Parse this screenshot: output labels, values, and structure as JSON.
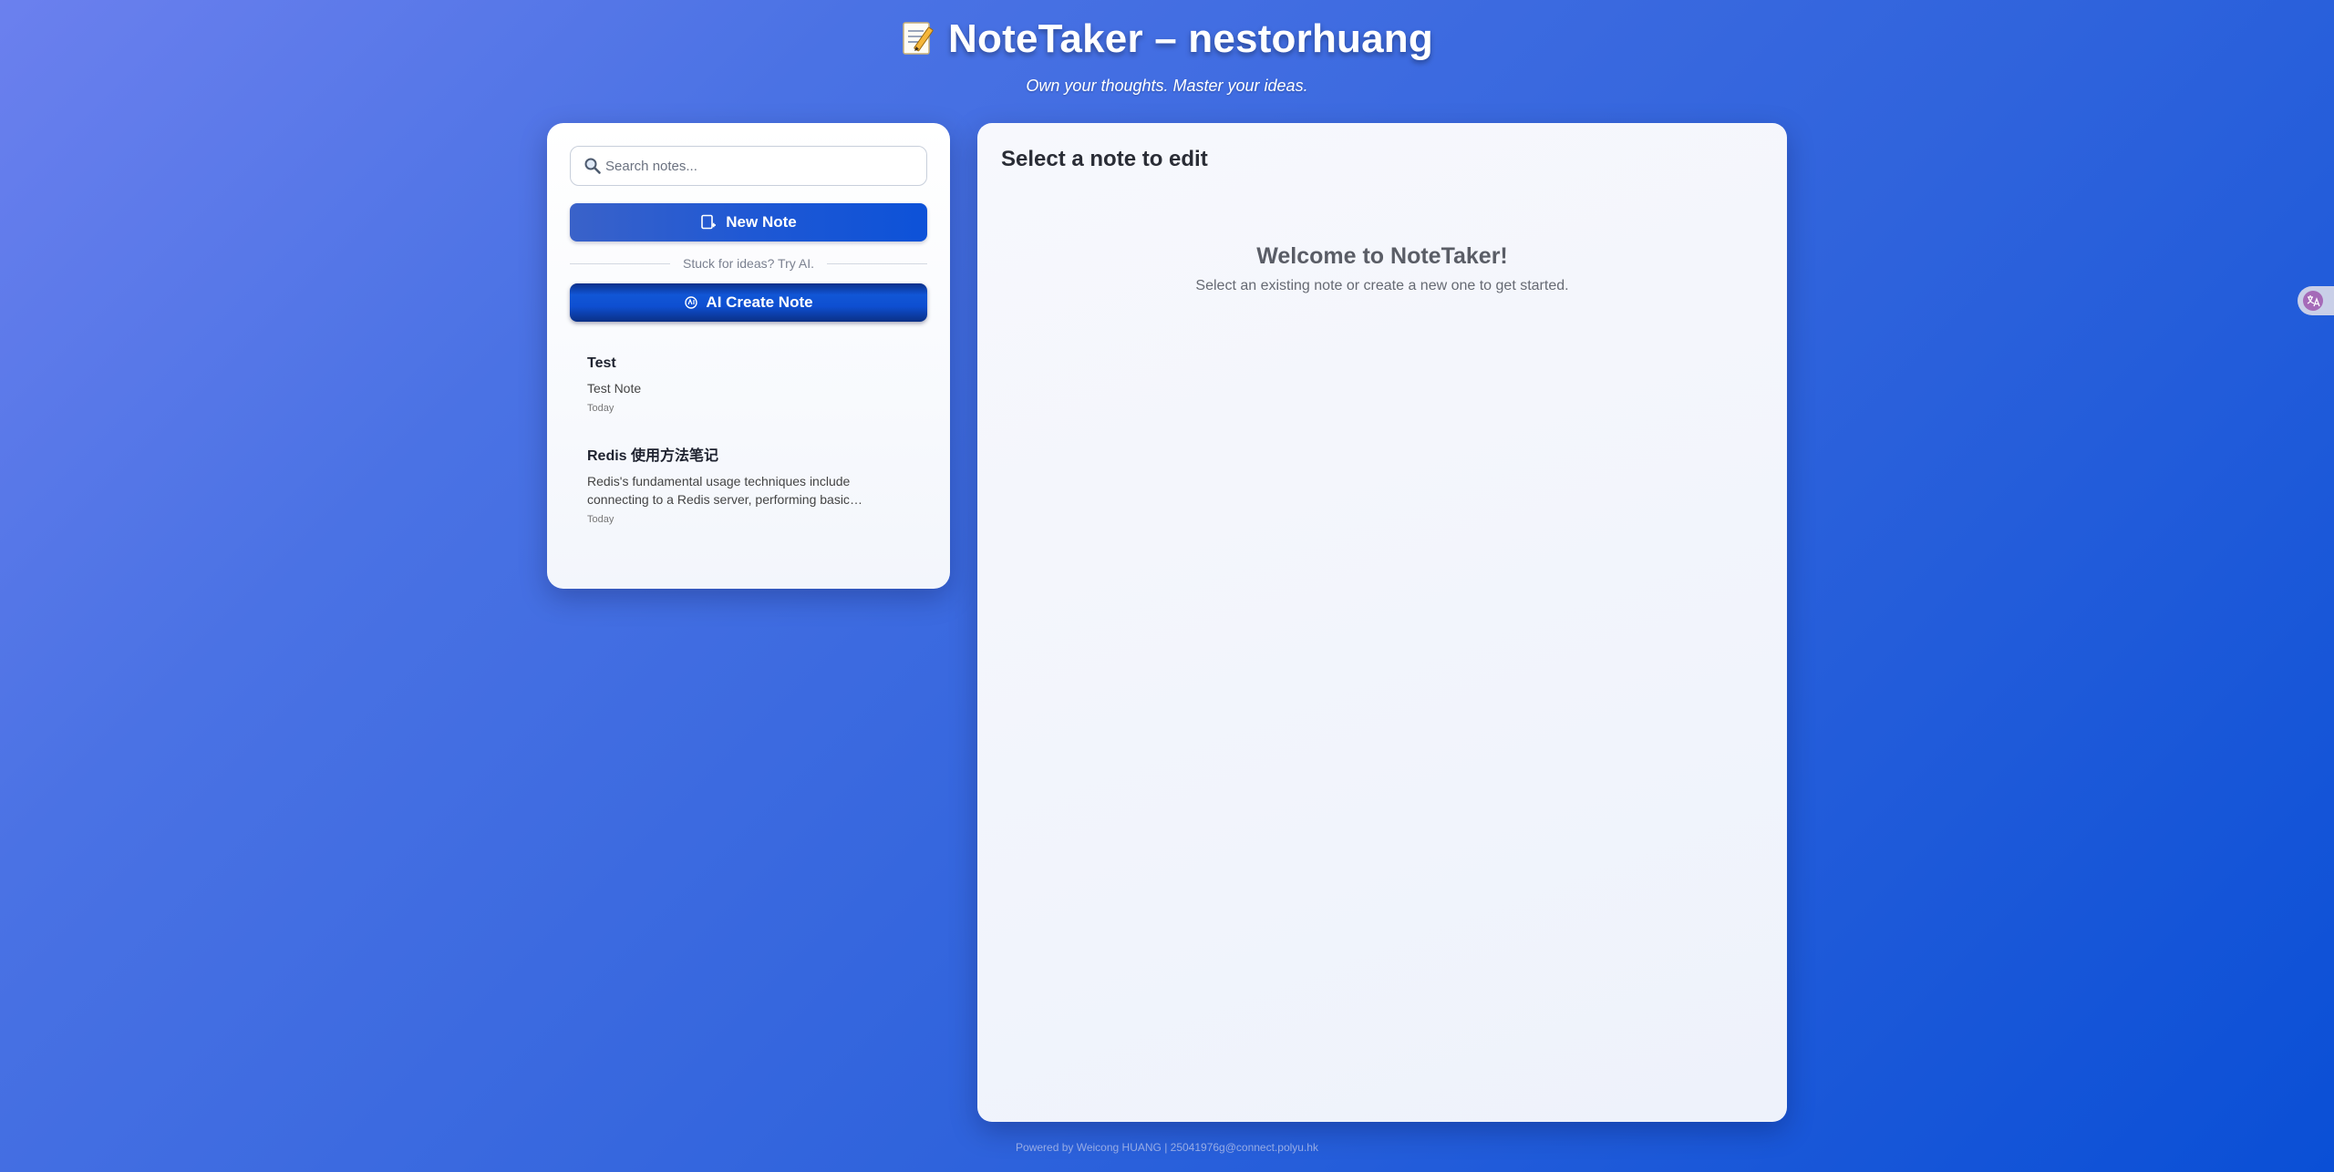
{
  "header": {
    "title": "NoteTaker – nestorhuang",
    "subtitle": "Own your thoughts. Master your ideas.",
    "icon": "memo-icon"
  },
  "sidebar": {
    "search": {
      "placeholder": "Search notes...",
      "value": "",
      "icon": "search-icon"
    },
    "new_note_label": "New Note",
    "new_note_icon": "new-note-icon",
    "divider_text": "Stuck for ideas? Try AI.",
    "ai_create_label": "AI Create Note",
    "ai_icon": "openai-icon",
    "notes": [
      {
        "title": "Test",
        "preview": "Test Note",
        "date": "Today"
      },
      {
        "title": "Redis 使用方法笔记",
        "preview": "Redis's fundamental usage techniques include connecting to a Redis server, performing basic operations",
        "date": "Today"
      }
    ]
  },
  "editor": {
    "heading": "Select a note to edit",
    "welcome_title": "Welcome to NoteTaker!",
    "welcome_text": "Select an existing note or create a new one to get started."
  },
  "side_widget": {
    "icon": "translate-icon"
  },
  "footer": {
    "text": "Powered by Weicong HUANG | 25041976g@connect.polyu.hk"
  },
  "colors": {
    "background_start": "#6b80ee",
    "background_end": "#0a4fd6",
    "primary_button": "#1f58d4",
    "ai_button": "#0b2f8a"
  }
}
